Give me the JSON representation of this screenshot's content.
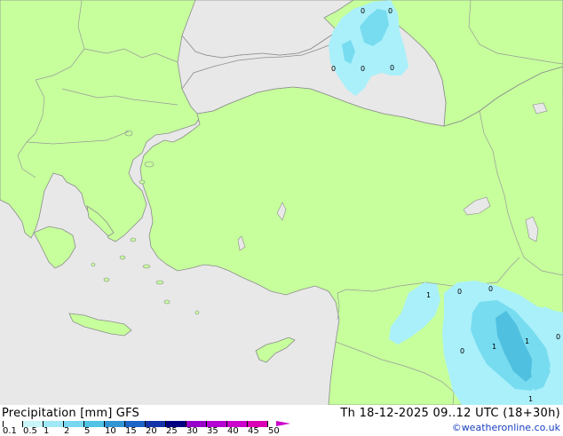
{
  "map": {
    "colors": {
      "sea": "#e8e8e8",
      "land": "#c6ff9c",
      "border": "#9a9a9a",
      "coast": "#8c8c8c",
      "precip_light": "#aaf0fa",
      "precip_mid": "#78dcf0",
      "precip_heavy": "#50c0e0"
    },
    "precip_labels": [
      "1",
      "1",
      "1",
      "1"
    ],
    "zero_labels": [
      "0",
      "0",
      "0",
      "0",
      "0",
      "0",
      "0",
      "0",
      "0"
    ]
  },
  "footer": {
    "title_left": "Precipitation [mm] GFS",
    "title_right": "Th 18-12-2025 09..12 UTC (18+30h)",
    "credit": "©weatheronline.co.uk"
  },
  "legend": {
    "ticks": [
      "0.1",
      "0.5",
      "1",
      "2",
      "5",
      "10",
      "15",
      "20",
      "25",
      "30",
      "35",
      "40",
      "45",
      "50"
    ],
    "colors": [
      "#ffffff",
      "#c8f5fa",
      "#a0e8f5",
      "#78d7f0",
      "#50c3e6",
      "#3296d2",
      "#1e64c8",
      "#1432aa",
      "#000080",
      "#9600c8",
      "#b400d2",
      "#cc00cc",
      "#dc00b4"
    ]
  }
}
